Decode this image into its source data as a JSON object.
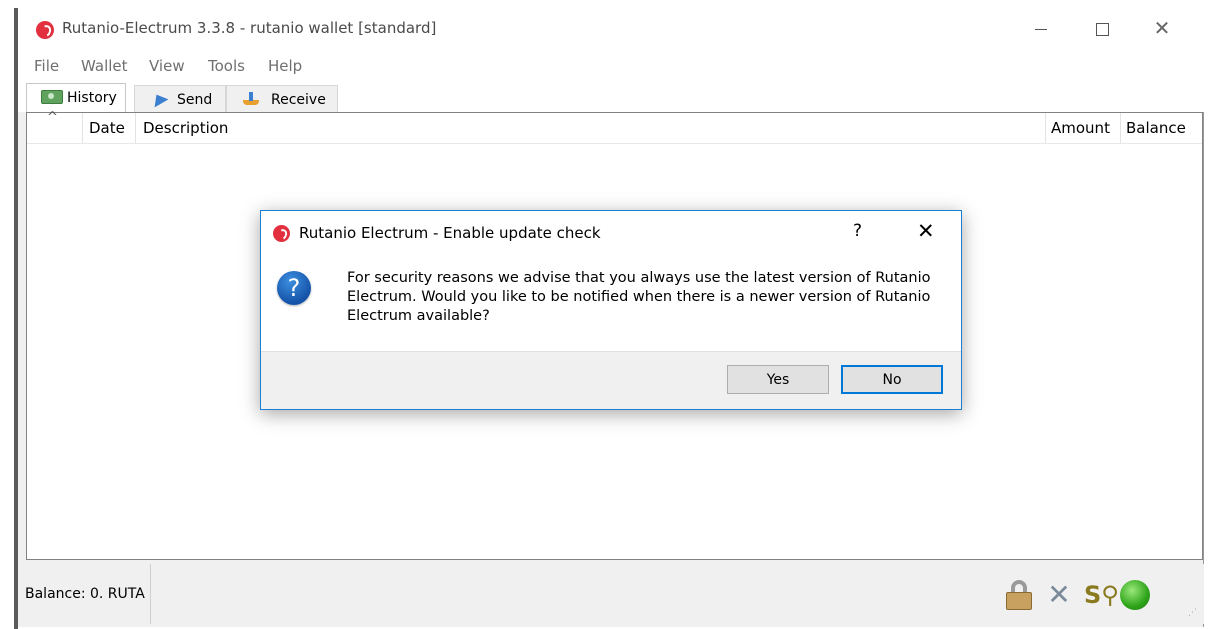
{
  "window": {
    "title": "Rutanio-Electrum 3.3.8  -  rutanio wallet  [standard]",
    "controls": {
      "minimize": "minimize",
      "maximize": "maximize",
      "close": "✕"
    }
  },
  "menu": [
    "File",
    "Wallet",
    "View",
    "Tools",
    "Help"
  ],
  "tabs": [
    {
      "label": "History",
      "icon": "history-icon",
      "active": true
    },
    {
      "label": "Send",
      "icon": "send-icon",
      "active": false
    },
    {
      "label": "Receive",
      "icon": "receive-icon",
      "active": false
    }
  ],
  "history_table": {
    "columns": [
      "Date",
      "Description",
      "Amount",
      "Balance"
    ],
    "rows": []
  },
  "status_bar": {
    "balance": "Balance: 0. RUTA",
    "icons": [
      "lock-icon",
      "tools-icon",
      "seed-icon",
      "network-status-icon"
    ]
  },
  "dialog": {
    "title": "Rutanio Electrum - Enable update check",
    "help": "?",
    "close": "✕",
    "message_lines": [
      "For security reasons we advise that you always use the latest version of Rutanio",
      "Electrum. Would you like to be notified when there is a newer version of Rutanio",
      "Electrum available?"
    ],
    "buttons": {
      "yes": "Yes",
      "no": "No"
    },
    "icon": "question-icon"
  },
  "colors": {
    "accent": "#0078d7",
    "app_icon": "#e2303f",
    "status_ok": "#2ea41a"
  }
}
